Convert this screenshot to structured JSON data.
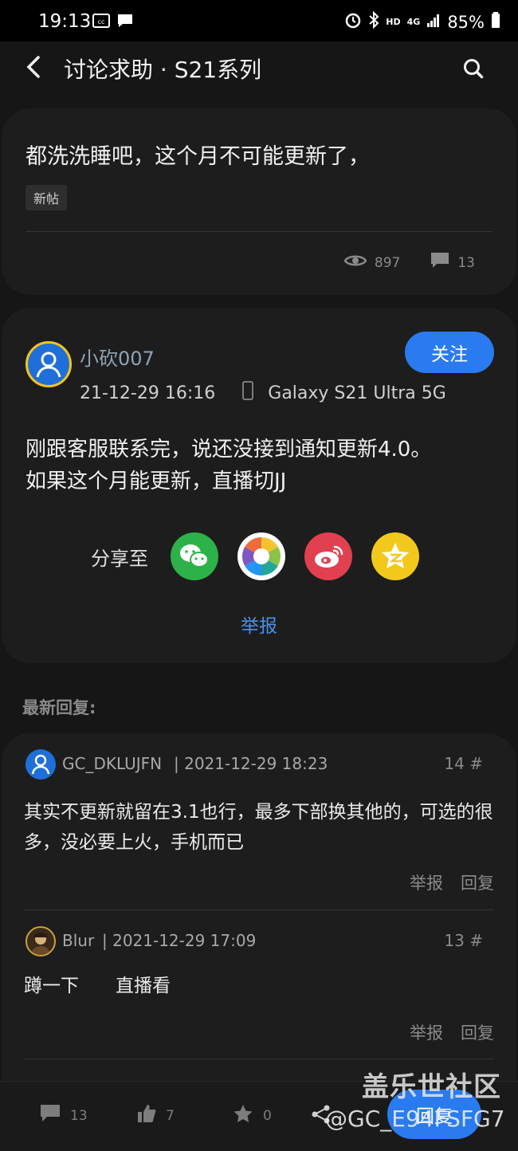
{
  "status_bar": {
    "time": "19:13",
    "network": "HD",
    "signal": "4G",
    "battery": "85%"
  },
  "header": {
    "title": "讨论求助 · S21系列"
  },
  "topic": {
    "title": "都洗洗睡吧，这个月不可能更新了，",
    "tag": "新帖",
    "views": "897",
    "comments": "13"
  },
  "post": {
    "author": "小砍007",
    "date": "21-12-29 16:16",
    "device": "Galaxy S21 Ultra 5G",
    "follow_label": "关注",
    "body_line1": "刚跟客服联系完，说还没接到通知更新4.0。",
    "body_line2": "如果这个月能更新，直播切JJ",
    "share_label": "分享至",
    "report_label": "举报"
  },
  "latest_label": "最新回复:",
  "replies": [
    {
      "name": "GC_DKLUJFN",
      "time": "| 2021-12-29 18:23",
      "floor": "14 #",
      "body": "其实不更新就留在3.1也行，最多下部换其他的，可选的很多，没必要上火，手机而已",
      "report": "举报",
      "reply": "回复"
    },
    {
      "name": "Blur",
      "time": "| 2021-12-29 17:09",
      "floor": "13 #",
      "body": "蹲一下　　直播看",
      "report": "举报",
      "reply": "回复"
    }
  ],
  "bottom_bar": {
    "comments": "13",
    "likes": "7",
    "favorites": "0",
    "reply_button": "回复"
  },
  "watermark": {
    "line1": "盖乐世社区",
    "line2": "@GC_E94FSFG7"
  },
  "colors": {
    "accent": "#2a7bf0",
    "card": "#1d1d1d",
    "background": "#161616"
  }
}
